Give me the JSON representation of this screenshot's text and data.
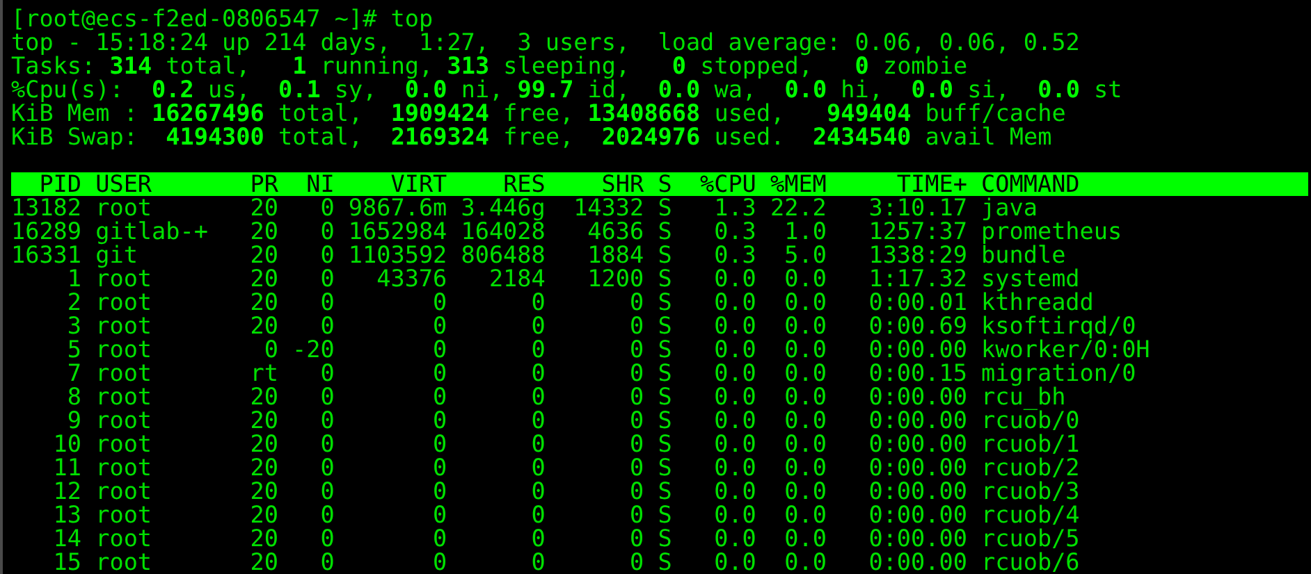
{
  "terminal": {
    "prompt": "[root@ecs-f2ed-0806547 ~]# top",
    "summary": [
      "top - 15:18:24 up 214 days,  1:27,  3 users,  load average: 0.06, 0.06, 0.52",
      "Tasks: **314** total,   **1** running, **313** sleeping,   **0** stopped,   **0** zombie",
      "%Cpu(s):  **0.2** us,  **0.1** sy,  **0.0** ni, **99.7** id,  **0.0** wa,  **0.0** hi,  **0.0** si,  **0.0** st",
      "KiB Mem : **16267496** total,  **1909424** free, **13408668** used,   **949404** buff/cache",
      "KiB Swap:  **4194300** total,  **2169324** free,  **2024976** used.  **2434540** avail Mem"
    ],
    "table": {
      "columns": [
        "PID",
        "USER",
        "PR",
        "NI",
        "VIRT",
        "RES",
        "SHR",
        "S",
        "%CPU",
        "%MEM",
        "TIME+",
        "COMMAND"
      ],
      "rows": [
        [
          "13182",
          "root",
          "20",
          "0",
          "9867.6m",
          "3.446g",
          "14332",
          "S",
          "1.3",
          "22.2",
          "3:10.17",
          "java"
        ],
        [
          "16289",
          "gitlab-+",
          "20",
          "0",
          "1652984",
          "164028",
          "4636",
          "S",
          "0.3",
          "1.0",
          "1257:37",
          "prometheus"
        ],
        [
          "16331",
          "git",
          "20",
          "0",
          "1103592",
          "806488",
          "1884",
          "S",
          "0.3",
          "5.0",
          "1338:29",
          "bundle"
        ],
        [
          "1",
          "root",
          "20",
          "0",
          "43376",
          "2184",
          "1200",
          "S",
          "0.0",
          "0.0",
          "1:17.32",
          "systemd"
        ],
        [
          "2",
          "root",
          "20",
          "0",
          "0",
          "0",
          "0",
          "S",
          "0.0",
          "0.0",
          "0:00.01",
          "kthreadd"
        ],
        [
          "3",
          "root",
          "20",
          "0",
          "0",
          "0",
          "0",
          "S",
          "0.0",
          "0.0",
          "0:00.69",
          "ksoftirqd/0"
        ],
        [
          "5",
          "root",
          "0",
          "-20",
          "0",
          "0",
          "0",
          "S",
          "0.0",
          "0.0",
          "0:00.00",
          "kworker/0:0H"
        ],
        [
          "7",
          "root",
          "rt",
          "0",
          "0",
          "0",
          "0",
          "S",
          "0.0",
          "0.0",
          "0:00.15",
          "migration/0"
        ],
        [
          "8",
          "root",
          "20",
          "0",
          "0",
          "0",
          "0",
          "S",
          "0.0",
          "0.0",
          "0:00.00",
          "rcu_bh"
        ],
        [
          "9",
          "root",
          "20",
          "0",
          "0",
          "0",
          "0",
          "S",
          "0.0",
          "0.0",
          "0:00.00",
          "rcuob/0"
        ],
        [
          "10",
          "root",
          "20",
          "0",
          "0",
          "0",
          "0",
          "S",
          "0.0",
          "0.0",
          "0:00.00",
          "rcuob/1"
        ],
        [
          "11",
          "root",
          "20",
          "0",
          "0",
          "0",
          "0",
          "S",
          "0.0",
          "0.0",
          "0:00.00",
          "rcuob/2"
        ],
        [
          "12",
          "root",
          "20",
          "0",
          "0",
          "0",
          "0",
          "S",
          "0.0",
          "0.0",
          "0:00.00",
          "rcuob/3"
        ],
        [
          "13",
          "root",
          "20",
          "0",
          "0",
          "0",
          "0",
          "S",
          "0.0",
          "0.0",
          "0:00.00",
          "rcuob/4"
        ],
        [
          "14",
          "root",
          "20",
          "0",
          "0",
          "0",
          "0",
          "S",
          "0.0",
          "0.0",
          "0:00.00",
          "rcuob/5"
        ],
        [
          "15",
          "root",
          "20",
          "0",
          "0",
          "0",
          "0",
          "S",
          "0.0",
          "0.0",
          "0:00.00",
          "rcuob/6"
        ]
      ]
    }
  }
}
